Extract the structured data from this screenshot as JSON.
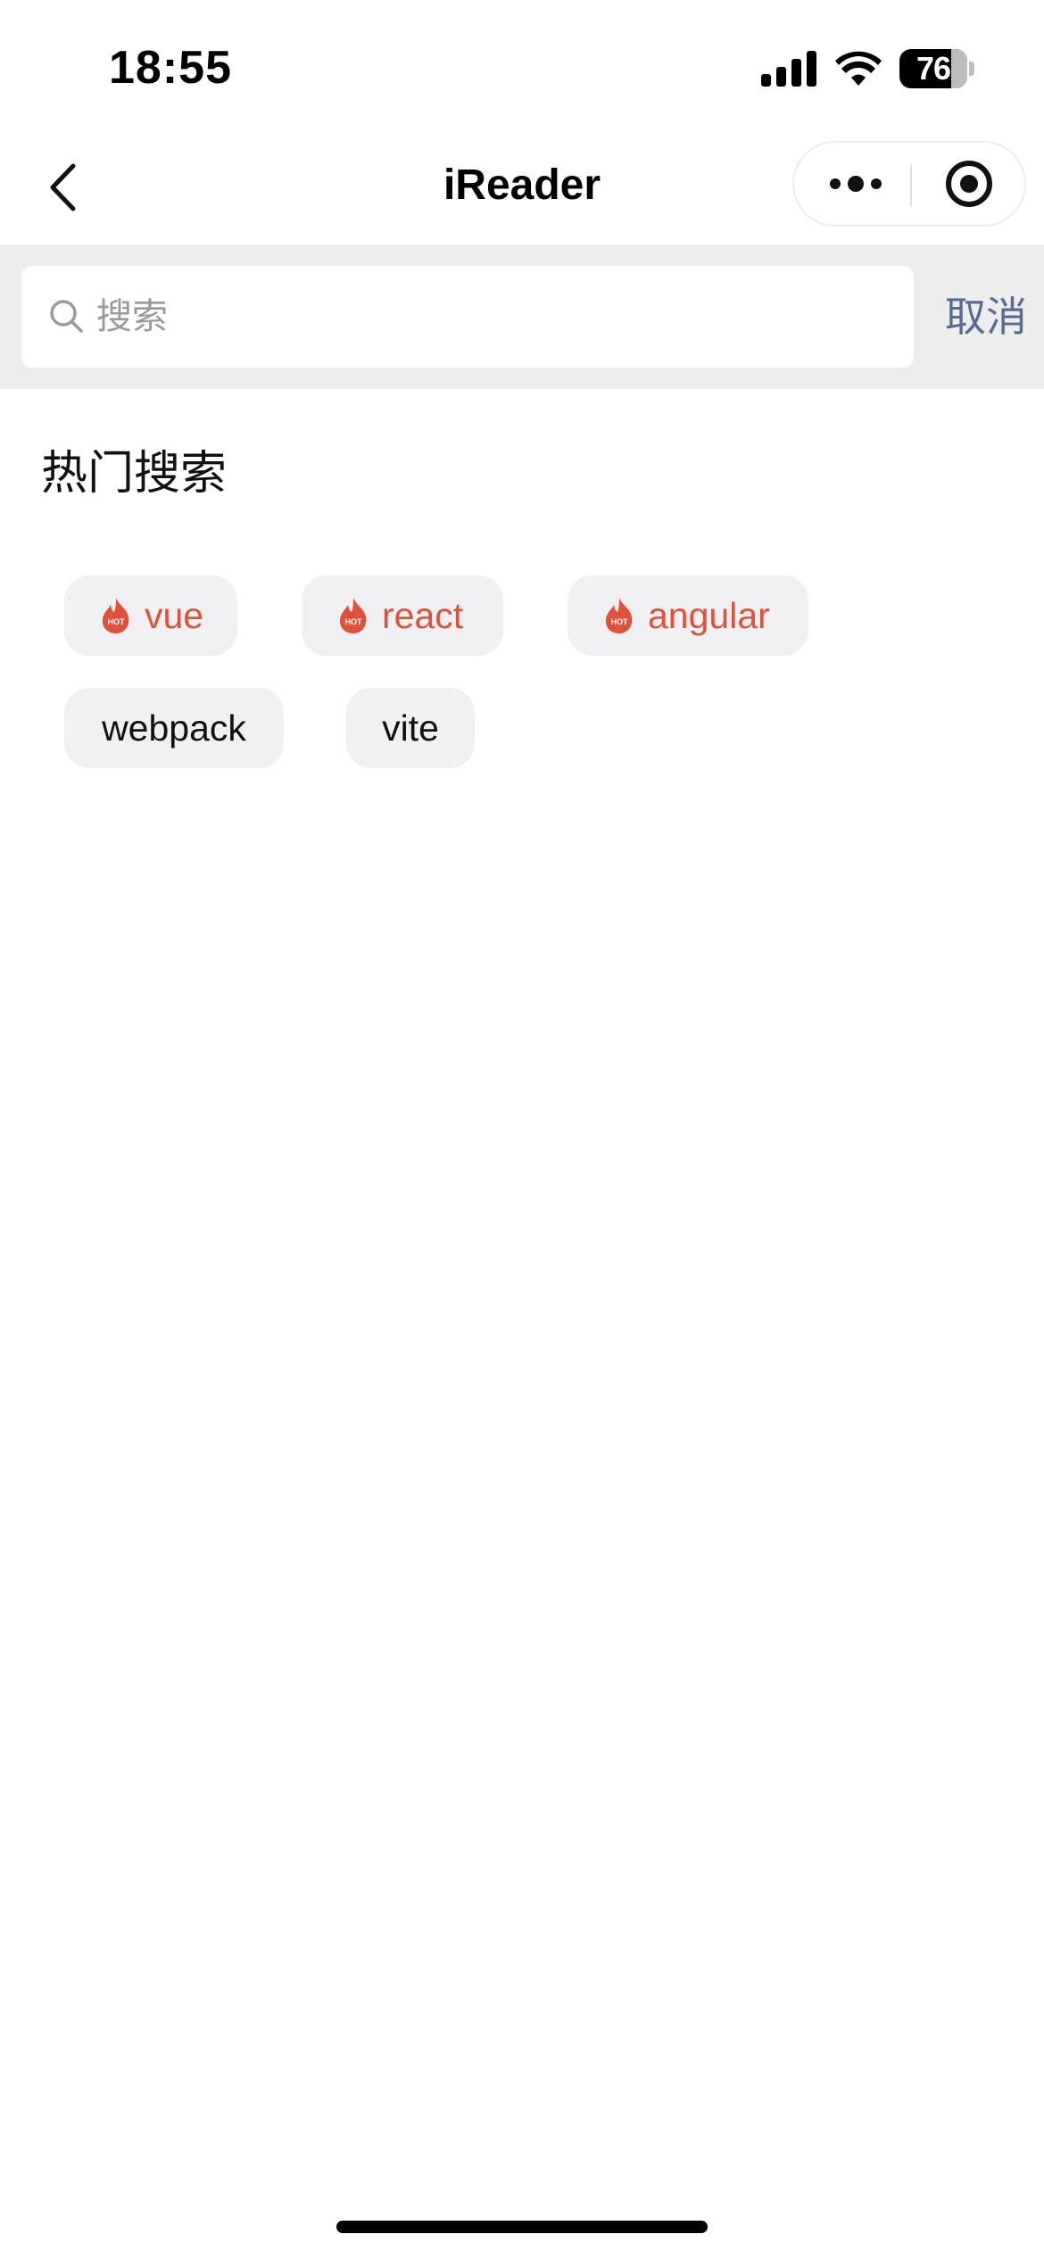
{
  "status_bar": {
    "time": "18:55",
    "battery_percent": "76",
    "battery_level": 0.76,
    "icons": [
      "signal-icon",
      "wifi-icon",
      "battery-icon"
    ]
  },
  "nav": {
    "title": "iReader",
    "icons": [
      "chevron-left-icon",
      "more-dots-icon",
      "close-target-icon"
    ]
  },
  "search": {
    "placeholder": "搜索",
    "value": "",
    "cancel_label": "取消"
  },
  "hot_search": {
    "title": "热门搜索",
    "hot_badge": "HOT",
    "tags": [
      {
        "label": "vue",
        "hot": true
      },
      {
        "label": "react",
        "hot": true
      },
      {
        "label": "angular",
        "hot": true
      },
      {
        "label": "webpack",
        "hot": false
      },
      {
        "label": "vite",
        "hot": false
      }
    ]
  },
  "colors": {
    "accent_link": "#576b95",
    "hot_red": "#e0513c",
    "tag_background": "#f0f0f2",
    "search_bar_background": "#ededed"
  }
}
